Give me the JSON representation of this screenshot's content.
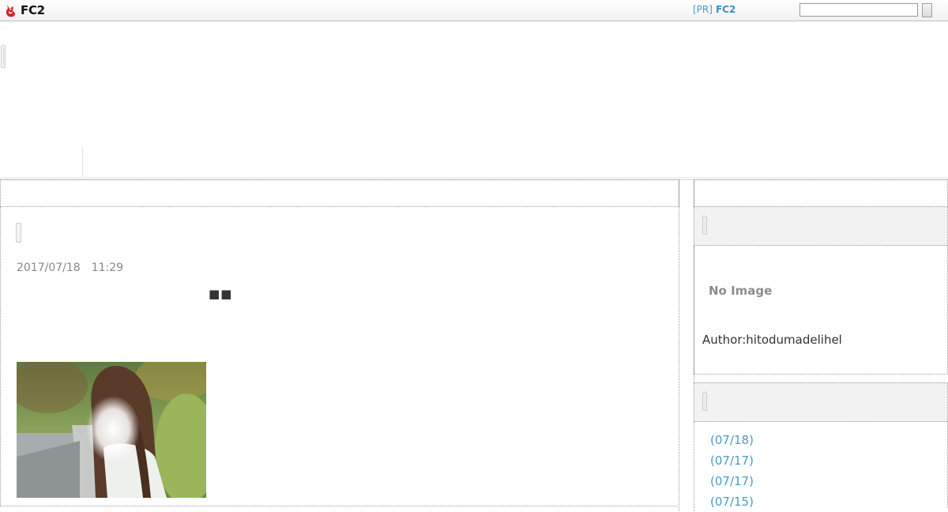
{
  "topbar": {
    "logo_text": "FC2",
    "pr_tag": "[PR]",
    "pr_link": "FC2",
    "search_placeholder": "",
    "search_button_label": ""
  },
  "entry": {
    "date": "2017/07/18",
    "time": "11:29",
    "title_glyphs": "■■"
  },
  "sidebar": {
    "profile": {
      "no_image_text": "No Image",
      "author_line": "Author:hitodumadelihel"
    },
    "recent_entries": [
      "(07/18)",
      "(07/17)",
      "(07/17)",
      "(07/15)"
    ]
  },
  "colors": {
    "link": "#4a9bc9",
    "box_header_bg": "#f2f2f2",
    "border": "#9a9a9a"
  }
}
